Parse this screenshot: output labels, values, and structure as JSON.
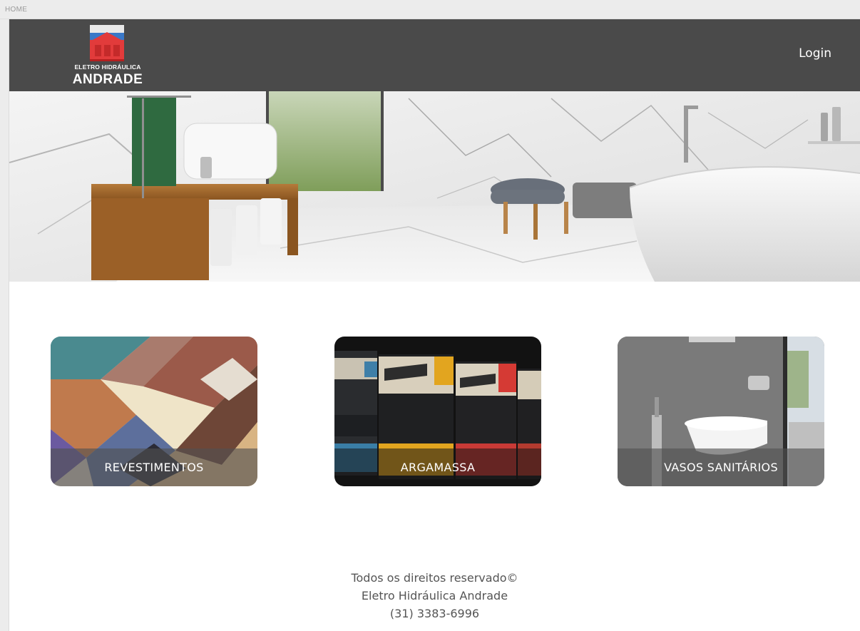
{
  "page": {
    "label": "HOME"
  },
  "header": {
    "logo": {
      "line1": "ELETRO HIDRÁULICA",
      "line2": "ANDRADE"
    },
    "login_label": "Login",
    "background_color": "#4a4a4a"
  },
  "hero": {
    "image": "bathroom-showroom-banner"
  },
  "categories": [
    {
      "label": "REVESTIMENTOS",
      "image": "tiles-chevron"
    },
    {
      "label": "ARGAMASSA",
      "image": "mortar-bags"
    },
    {
      "label": "VASOS SANITÁRIOS",
      "image": "wall-hung-toilet"
    }
  ],
  "footer": {
    "line1": "Todos os direitos reservado©",
    "line2": "Eletro Hidráulica Andrade",
    "line3": "(31) 3383-6996"
  }
}
